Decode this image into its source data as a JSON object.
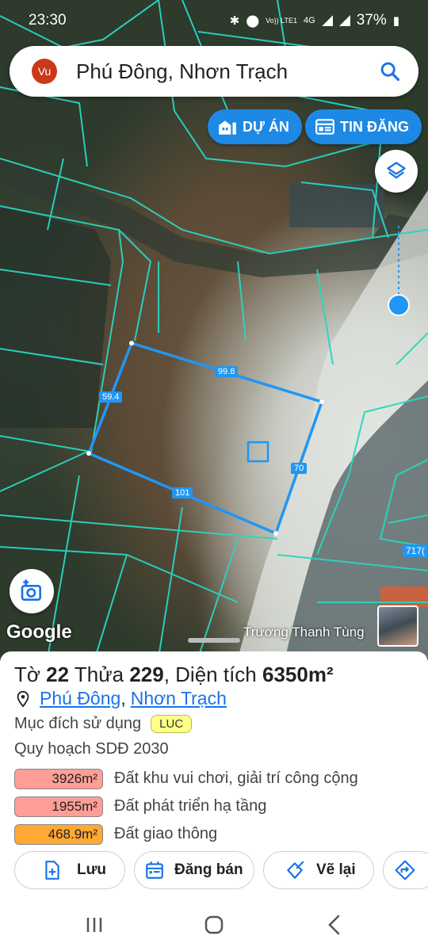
{
  "status_bar": {
    "time": "23:30",
    "network": "Vo)) LTE1",
    "network_type": "4G",
    "battery": "37%"
  },
  "search": {
    "avatar_initials": "Vu",
    "title": "Phú Đông, Nhơn Trạch",
    "avatar_color": "#c9391a"
  },
  "chips": {
    "du_an": "DỰ ÁN",
    "tin_dang": "TIN ĐĂNG",
    "color": "#1e88e5"
  },
  "map": {
    "edge_labels": [
      "99.8",
      "59.4",
      "70",
      "101"
    ],
    "corner_label": "717(",
    "brand": "Google",
    "author": "Trương Thanh Tùng",
    "parcel_line_color": "#2196f3",
    "cadastral_line_color": "#2ad5c0"
  },
  "parcel": {
    "prefix_to": "Tờ",
    "sheet": "22",
    "prefix_thua": "Thửa",
    "plot": "229",
    "prefix_area": ", Diện tích",
    "area": "6350m²",
    "ward": "Phú Đông",
    "separator": ",",
    "district": "Nhơn Trạch",
    "purpose_label": "Mục đích sử dụng",
    "purpose_code": "LUC",
    "plan_label": "Quy hoạch SDĐ 2030",
    "plan_items": [
      {
        "area": "3926m²",
        "desc": "Đất khu vui chơi, giải trí công cộng",
        "color": "#ff9e96"
      },
      {
        "area": "1955m²",
        "desc": "Đất phát triển hạ tầng",
        "color": "#ff9e96"
      },
      {
        "area": "468.9m²",
        "desc": "Đất giao thông",
        "color": "#ffa833"
      }
    ]
  },
  "actions": {
    "save": "Lưu",
    "sell": "Đăng bán",
    "redraw": "Vẽ lại"
  }
}
